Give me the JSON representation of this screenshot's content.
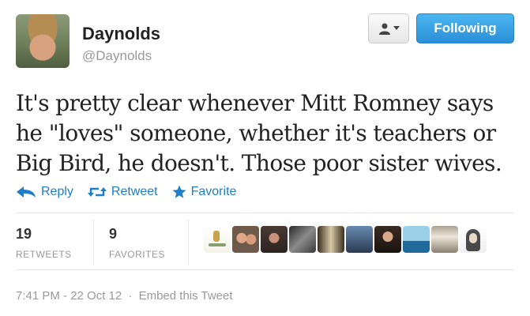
{
  "user": {
    "name": "Daynolds",
    "handle": "@Daynolds"
  },
  "follow_button": {
    "label": "Following"
  },
  "tweet": {
    "text": "It's pretty clear whenever Mitt Romney says he \"loves\" someone, whether it's teachers or Big Bird, he doesn't. Those poor sister wives."
  },
  "actions": {
    "reply": "Reply",
    "retweet": "Retweet",
    "favorite": "Favorite"
  },
  "stats": {
    "retweets_count": "19",
    "retweets_label": "RETWEETS",
    "favorites_count": "9",
    "favorites_label": "FAVORITES"
  },
  "meta": {
    "timestamp": "7:41 PM - 22 Oct 12",
    "separator": "·",
    "embed": "Embed this Tweet"
  },
  "colors": {
    "link": "#1f7ec8",
    "follow_button": "#2a8fd8"
  }
}
